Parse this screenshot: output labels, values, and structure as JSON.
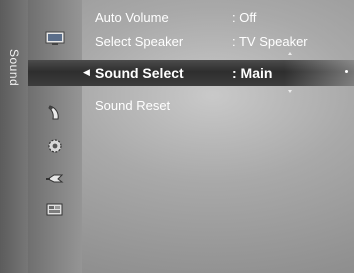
{
  "category": {
    "label": "Sound"
  },
  "icons": [
    {
      "name": "picture-icon"
    },
    {
      "name": "sound-icon",
      "active": true
    },
    {
      "name": "channel-icon"
    },
    {
      "name": "setup-icon"
    },
    {
      "name": "input-icon"
    },
    {
      "name": "application-icon"
    }
  ],
  "menu": {
    "items": [
      {
        "label": "Auto Volume",
        "value": ": Off"
      },
      {
        "label": "Select Speaker",
        "value": ": TV Speaker"
      },
      {
        "label": "Sound Select",
        "value": ": Main",
        "selected": true,
        "marker": "◀"
      },
      {
        "label": "Sound Reset",
        "value": ""
      }
    ]
  },
  "colors": {
    "highlight": "#3a3a3a",
    "text": "#ffffff",
    "background": "#a9a9a9"
  }
}
